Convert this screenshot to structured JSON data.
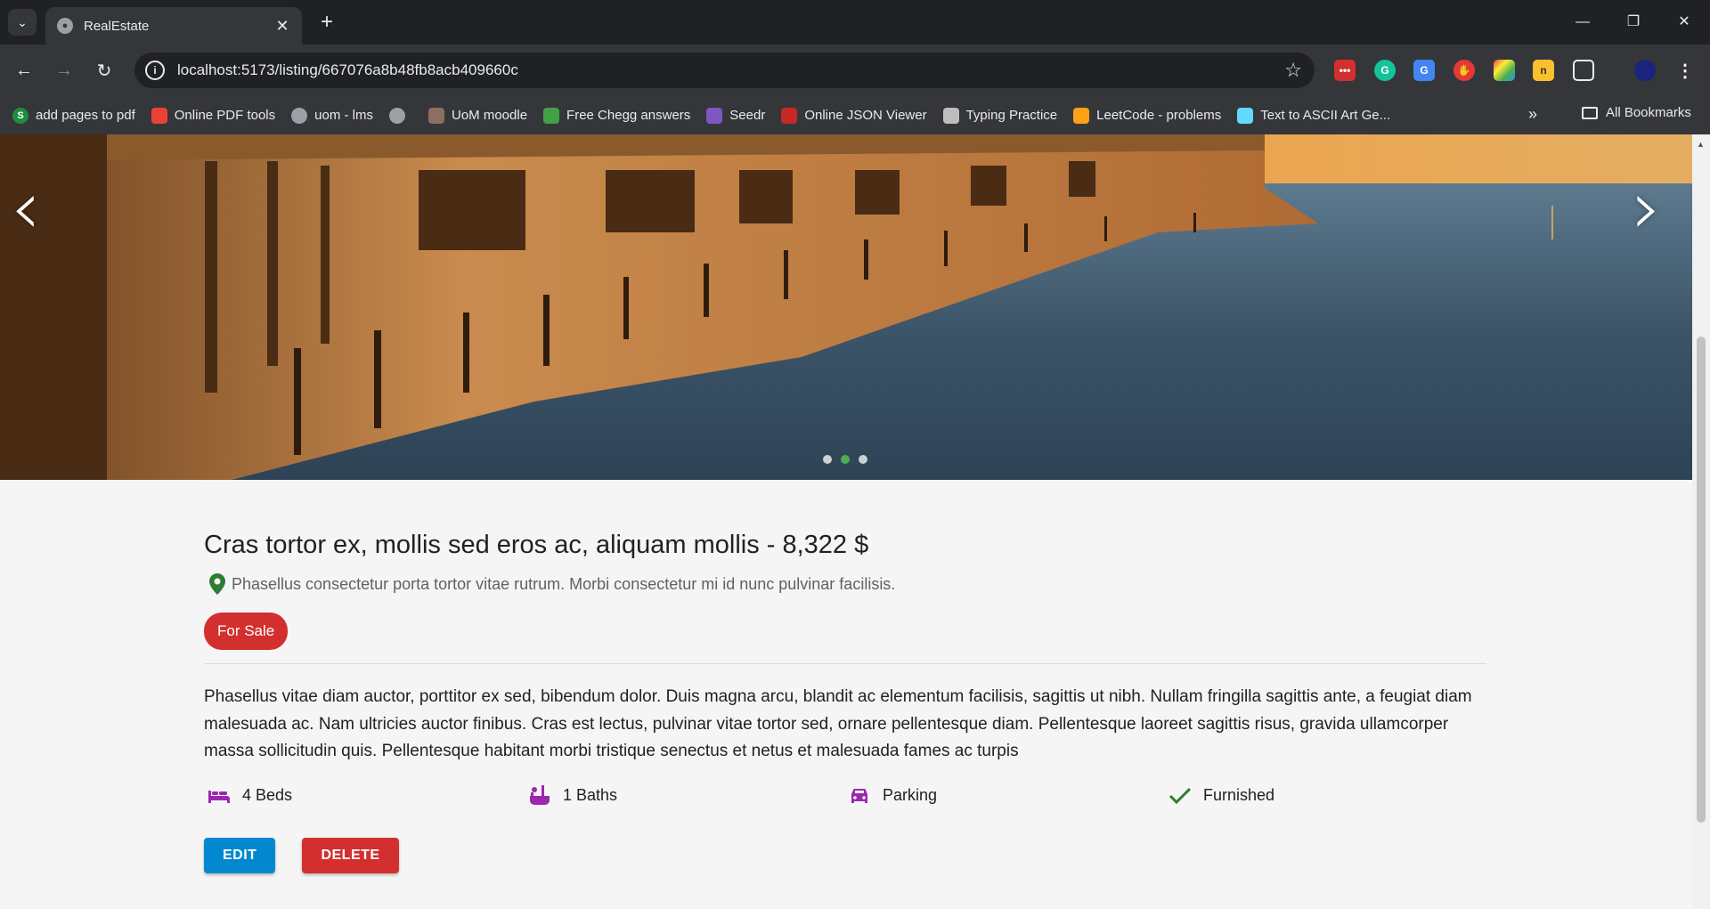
{
  "browser": {
    "tab_title": "RealEstate",
    "url": "localhost:5173/listing/667076a8b48fb8acb409660c",
    "bookmarks": [
      {
        "label": "add pages to pdf",
        "icon": "s-icon",
        "color": "#1e8e3e"
      },
      {
        "label": "Online PDF tools",
        "icon": "heart-icon",
        "color": "#ea4335"
      },
      {
        "label": "uom - lms",
        "icon": "globe-icon",
        "color": "#9aa0a6"
      },
      {
        "label": "",
        "icon": "globe-icon",
        "color": "#9aa0a6"
      },
      {
        "label": "UoM moodle",
        "icon": "moodle-icon",
        "color": "#8d6e63"
      },
      {
        "label": "Free Chegg answers",
        "icon": "books-icon",
        "color": "#43a047"
      },
      {
        "label": "Seedr",
        "icon": "seed-icon",
        "color": "#7e57c2"
      },
      {
        "label": "Online JSON Viewer",
        "icon": "json-icon",
        "color": "#c62828"
      },
      {
        "label": "Typing Practice",
        "icon": "keyboard-icon",
        "color": "#bdbdbd"
      },
      {
        "label": "LeetCode - problems",
        "icon": "leetcode-icon",
        "color": "#ffa116"
      },
      {
        "label": "Text to ASCII Art Ge...",
        "icon": "react-icon",
        "color": "#61dafb"
      }
    ],
    "all_bookmarks_label": "All Bookmarks"
  },
  "listing": {
    "title": "Cras tortor ex, mollis sed eros ac, aliquam mollis - 8,322 $",
    "address": "Phasellus consectetur porta tortor vitae rutrum. Morbi consectetur mi id nunc pulvinar facilisis.",
    "type_badge": "For Sale",
    "description": "Phasellus vitae diam auctor, porttitor ex sed, bibendum dolor. Duis magna arcu, blandit ac elementum facilisis, sagittis ut nibh. Nullam fringilla sagittis ante, a feugiat diam malesuada ac. Nam ultricies auctor finibus. Cras est lectus, pulvinar vitae tortor sed, ornare pellentesque diam. Pellentesque laoreet sagittis risus, gravida ullamcorper massa sollicitudin quis. Pellentesque habitant morbi tristique senectus et netus et malesuada fames ac turpis",
    "features": {
      "beds": "4 Beds",
      "baths": "1 Baths",
      "parking": "Parking",
      "furnished": "Furnished"
    },
    "edit_label": "EDIT",
    "delete_label": "DELETE"
  },
  "carousel": {
    "slide_count": 3,
    "active_slide": 2
  },
  "colors": {
    "feature_icon": "#9c27b0",
    "check_icon": "#2e7d32",
    "edit_button": "#0288d1",
    "delete_button": "#d32f2f",
    "pin_icon": "#2e7d32"
  }
}
